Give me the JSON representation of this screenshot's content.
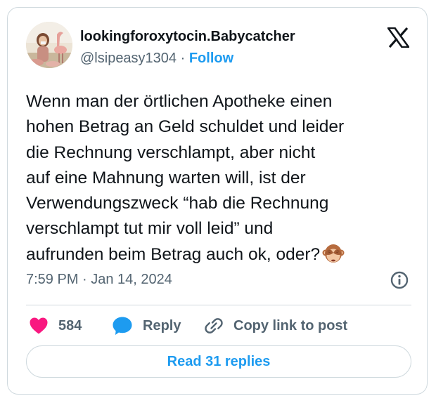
{
  "author": {
    "display_name": "lookingforoxytocin.Babycatcher",
    "handle": "@lsipeasy1304",
    "separator": " · ",
    "follow_label": "Follow"
  },
  "tweet": {
    "text": "Wenn man der örtlichen Apotheke einen\nhohen Betrag an Geld schuldet und leider\ndie Rechnung verschlampt, aber nicht\nauf eine Mahnung warten will, ist der\nVerwendungszweck “hab die Rechnung\nverschlampt tut mir voll leid” und\naufrunden beim Betrag auch ok, oder?",
    "emoji": "see-no-evil-monkey",
    "timestamp": "7:59 PM · Jan 14, 2024"
  },
  "actions": {
    "like_count": "584",
    "reply_label": "Reply",
    "copy_link_label": "Copy link to post"
  },
  "read_replies_label": "Read 31 replies",
  "colors": {
    "accent": "#1d9bf0",
    "like": "#f91880",
    "text": "#0f1419",
    "muted": "#536471",
    "border": "#cfd9de"
  },
  "icons": [
    "avatar-photo",
    "x-logo-icon",
    "info-icon",
    "heart-icon",
    "speech-bubble-icon",
    "link-icon",
    "see-no-evil-monkey-emoji"
  ]
}
